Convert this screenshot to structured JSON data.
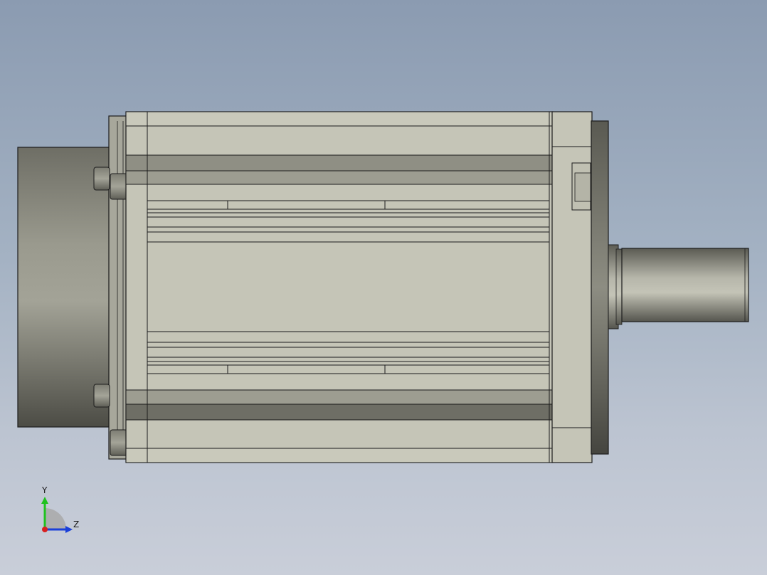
{
  "viewport": {
    "background_top": "#8b9bb1",
    "background_bottom": "#c9ced9"
  },
  "model": {
    "description_name": "servo-motor-side-view",
    "body_color": "#c5c5b7",
    "shade_color": "#8e8e83",
    "edge_color": "#1c1c1c"
  },
  "triad": {
    "y_label": "Y",
    "z_label": "Z",
    "y_color": "#1fc21f",
    "z_color": "#1a3fd9",
    "x_color": "#d82020"
  }
}
